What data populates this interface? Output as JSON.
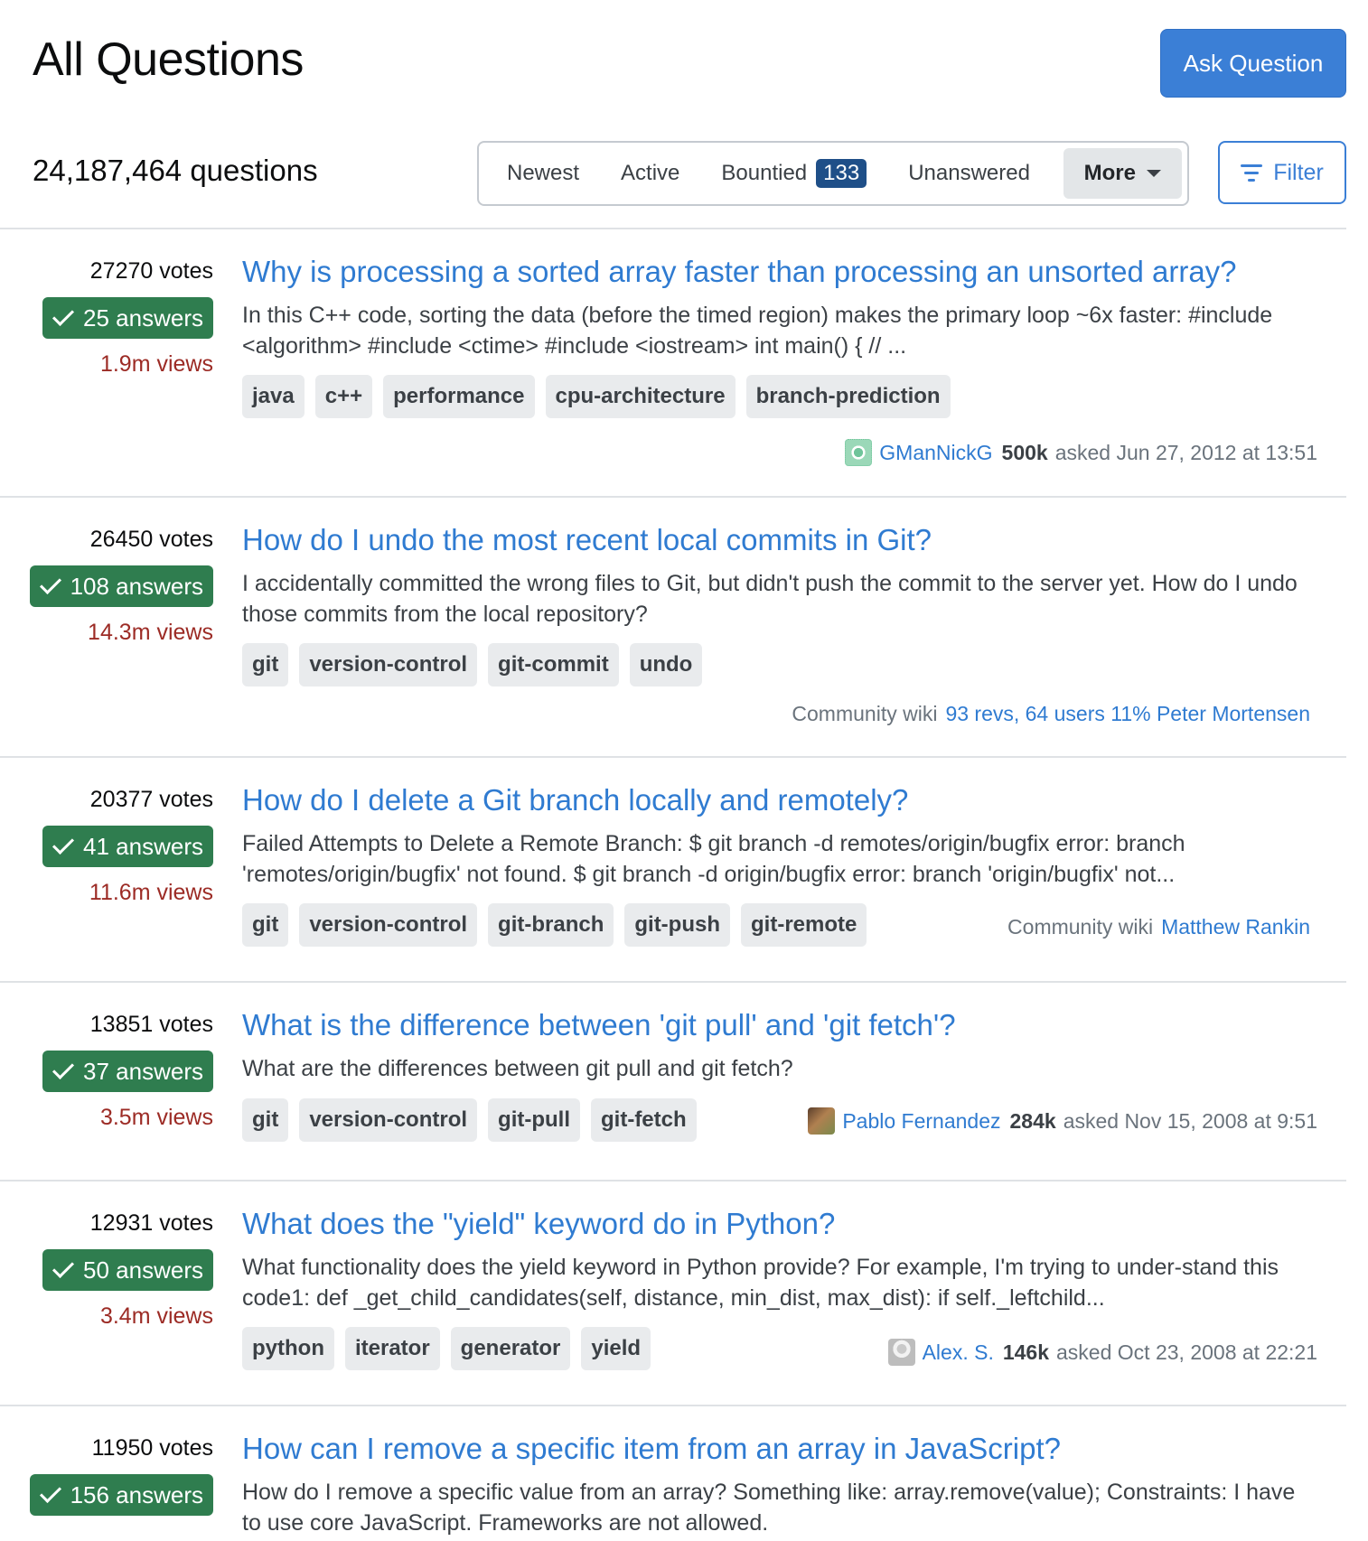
{
  "header": {
    "title": "All Questions",
    "ask_button": "Ask Question",
    "question_count": "24,187,464 questions"
  },
  "tabs": {
    "newest": "Newest",
    "active": "Active",
    "bountied": "Bountied",
    "bountied_count": "133",
    "unanswered": "Unanswered",
    "more": "More"
  },
  "filter_label": "Filter",
  "questions": [
    {
      "votes": "27270 votes",
      "answers": "25 answers",
      "views": "1.9m views",
      "title": "Why is processing a sorted array faster than processing an unsorted array?",
      "excerpt": "In this C++ code, sorting the data (before the timed region) makes the primary loop ~6x faster: #include <algorithm> #include <ctime> #include <iostream> int main() { // ...",
      "tags": [
        "java",
        "c++",
        "performance",
        "cpu-architecture",
        "branch-prediction"
      ],
      "user": "GManNickG",
      "rep": "500k",
      "asked": "asked Jun 27, 2012 at 13:51"
    },
    {
      "votes": "26450 votes",
      "answers": "108 answers",
      "views": "14.3m views",
      "title": "How do I undo the most recent local commits in Git?",
      "excerpt": "I accidentally committed the wrong files to Git, but didn't push the commit to the server yet. How do I undo those commits from the local repository?",
      "tags": [
        "git",
        "version-control",
        "git-commit",
        "undo"
      ],
      "wiki_label": "Community wiki",
      "wiki_link": "93 revs, 64 users 11% Peter Mortensen"
    },
    {
      "votes": "20377 votes",
      "answers": "41 answers",
      "views": "11.6m views",
      "title": "How do I delete a Git branch locally and remotely?",
      "excerpt": "Failed Attempts to Delete a Remote Branch: $ git branch -d remotes/origin/bugfix error: branch 'remotes/origin/bugfix' not found. $ git branch -d origin/bugfix error: branch 'origin/bugfix' not...",
      "tags": [
        "git",
        "version-control",
        "git-branch",
        "git-push",
        "git-remote"
      ],
      "wiki_label": "Community wiki",
      "wiki_link": "Matthew Rankin"
    },
    {
      "votes": "13851 votes",
      "answers": "37 answers",
      "views": "3.5m views",
      "title": "What is the difference between 'git pull' and 'git fetch'?",
      "excerpt": "What are the differences between git pull and git fetch?",
      "tags": [
        "git",
        "version-control",
        "git-pull",
        "git-fetch"
      ],
      "user": "Pablo Fernandez",
      "rep": "284k",
      "asked": "asked Nov 15, 2008 at 9:51"
    },
    {
      "votes": "12931 votes",
      "answers": "50 answers",
      "views": "3.4m views",
      "title": "What does the \"yield\" keyword do in Python?",
      "excerpt": "What functionality does the yield keyword in Python provide? For example, I'm trying to under-stand this code1: def _get_child_candidates(self, distance, min_dist, max_dist): if self._leftchild...",
      "tags": [
        "python",
        "iterator",
        "generator",
        "yield"
      ],
      "user": "Alex. S.",
      "rep": "146k",
      "asked": "asked Oct 23, 2008 at 22:21"
    },
    {
      "votes": "11950 votes",
      "answers": "156 answers",
      "title": "How can I remove a specific item from an array in JavaScript?",
      "excerpt": "How do I remove a specific value from an array? Something like: array.remove(value); Constraints: I have to use core JavaScript. Frameworks are not allowed."
    }
  ],
  "colors": {
    "link": "#2f7bd1",
    "primary_button": "#3b7fd6",
    "answered_badge": "#2f7d4f",
    "views_text": "#9c2b25",
    "bounty_badge": "#1f4f88",
    "tag_bg": "#e9ebed"
  },
  "icons": {
    "filter": "filter-lines-icon",
    "answered": "checkmark-icon",
    "more": "chevron-down-icon"
  }
}
